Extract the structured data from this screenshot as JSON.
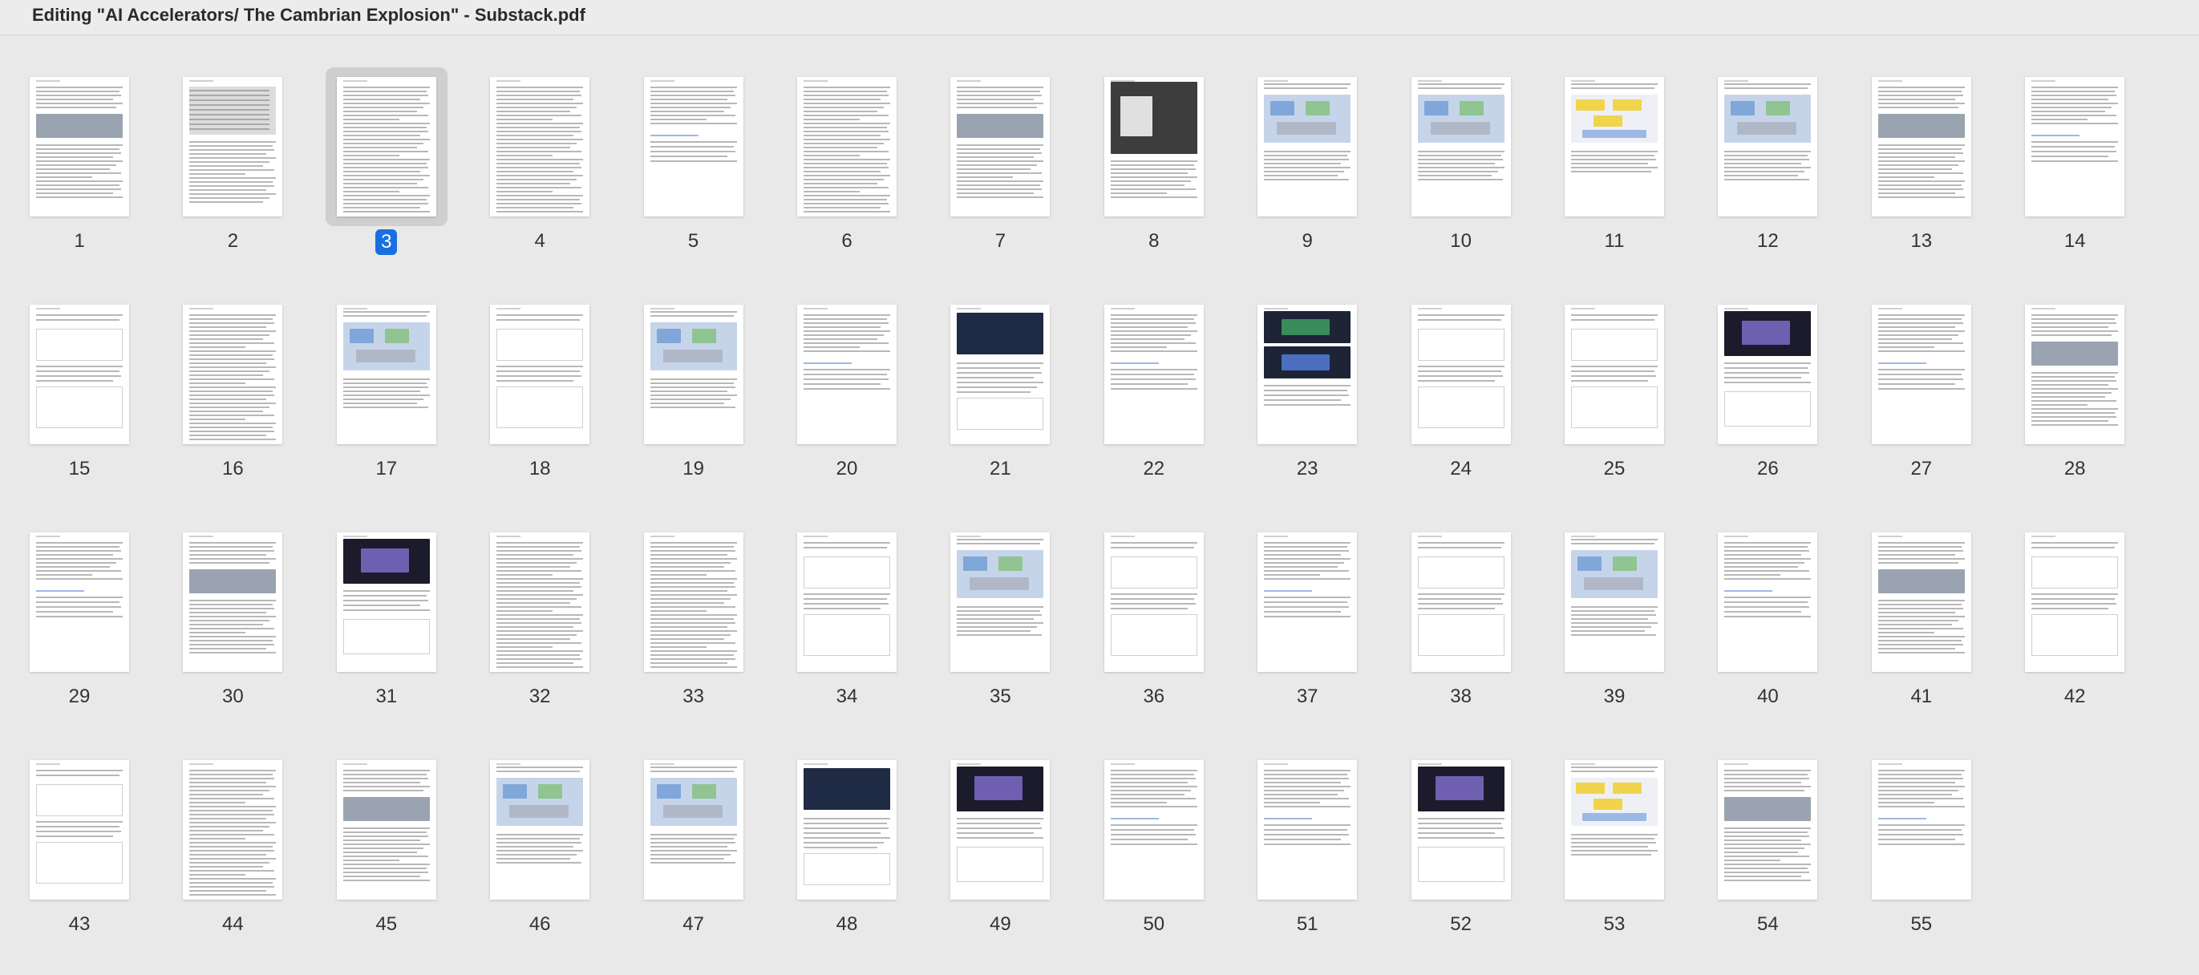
{
  "window": {
    "title": "Editing \"AI Accelerators/ The Cambrian Explosion\" - Substack.pdf"
  },
  "selected_page": "3",
  "pages": [
    {
      "label": "1",
      "kind": "text-img"
    },
    {
      "label": "2",
      "kind": "table"
    },
    {
      "label": "3",
      "kind": "text"
    },
    {
      "label": "4",
      "kind": "text"
    },
    {
      "label": "5",
      "kind": "text-light"
    },
    {
      "label": "6",
      "kind": "text"
    },
    {
      "label": "7",
      "kind": "text-img"
    },
    {
      "label": "8",
      "kind": "photo"
    },
    {
      "label": "9",
      "kind": "diagram"
    },
    {
      "label": "10",
      "kind": "diagram"
    },
    {
      "label": "11",
      "kind": "diagram-yellow"
    },
    {
      "label": "12",
      "kind": "diagram"
    },
    {
      "label": "13",
      "kind": "text-img"
    },
    {
      "label": "14",
      "kind": "text-light"
    },
    {
      "label": "15",
      "kind": "sparse"
    },
    {
      "label": "16",
      "kind": "text"
    },
    {
      "label": "17",
      "kind": "diagram"
    },
    {
      "label": "18",
      "kind": "sparse"
    },
    {
      "label": "19",
      "kind": "diagram"
    },
    {
      "label": "20",
      "kind": "text-light"
    },
    {
      "label": "21",
      "kind": "photo-dark"
    },
    {
      "label": "22",
      "kind": "text-light"
    },
    {
      "label": "23",
      "kind": "dark-slides"
    },
    {
      "label": "24",
      "kind": "sparse"
    },
    {
      "label": "25",
      "kind": "sparse"
    },
    {
      "label": "26",
      "kind": "dark-slide"
    },
    {
      "label": "27",
      "kind": "text-light"
    },
    {
      "label": "28",
      "kind": "text-img"
    },
    {
      "label": "29",
      "kind": "text-light"
    },
    {
      "label": "30",
      "kind": "text-img"
    },
    {
      "label": "31",
      "kind": "dark-slide"
    },
    {
      "label": "32",
      "kind": "text"
    },
    {
      "label": "33",
      "kind": "text"
    },
    {
      "label": "34",
      "kind": "sparse"
    },
    {
      "label": "35",
      "kind": "diagram"
    },
    {
      "label": "36",
      "kind": "sparse"
    },
    {
      "label": "37",
      "kind": "text-light"
    },
    {
      "label": "38",
      "kind": "sparse"
    },
    {
      "label": "39",
      "kind": "diagram"
    },
    {
      "label": "40",
      "kind": "text-light"
    },
    {
      "label": "41",
      "kind": "text-img"
    },
    {
      "label": "42",
      "kind": "sparse"
    },
    {
      "label": "43",
      "kind": "sparse"
    },
    {
      "label": "44",
      "kind": "text"
    },
    {
      "label": "45",
      "kind": "text-img"
    },
    {
      "label": "46",
      "kind": "diagram"
    },
    {
      "label": "47",
      "kind": "diagram"
    },
    {
      "label": "48",
      "kind": "photo-dark"
    },
    {
      "label": "49",
      "kind": "dark-slide"
    },
    {
      "label": "50",
      "kind": "text-light"
    },
    {
      "label": "51",
      "kind": "text-light"
    },
    {
      "label": "52",
      "kind": "dark-slide"
    },
    {
      "label": "53",
      "kind": "diagram-yellow"
    },
    {
      "label": "54",
      "kind": "text-img"
    },
    {
      "label": "55",
      "kind": "text-light"
    }
  ]
}
